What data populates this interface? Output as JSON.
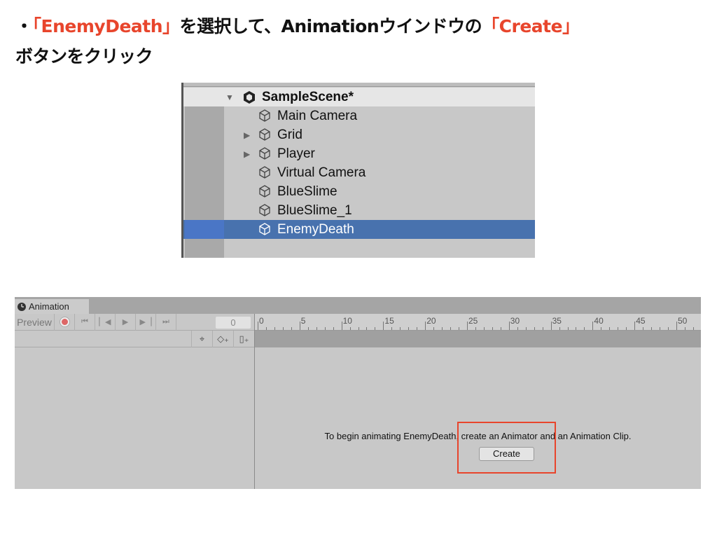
{
  "instruction": {
    "line1": [
      {
        "text": "・",
        "red": false
      },
      {
        "text": "「EnemyDeath」",
        "red": true
      },
      {
        "text": "を選択して、Animationウインドウの",
        "red": false
      },
      {
        "text": "「Create」",
        "red": true
      }
    ],
    "line2": "ボタンをクリック"
  },
  "hierarchy": {
    "scene": "SampleScene*",
    "items": [
      {
        "label": "Main Camera",
        "expandable": false
      },
      {
        "label": "Grid",
        "expandable": true
      },
      {
        "label": "Player",
        "expandable": true
      },
      {
        "label": "Virtual Camera",
        "expandable": false
      },
      {
        "label": "BlueSlime",
        "expandable": false
      },
      {
        "label": "BlueSlime_1",
        "expandable": false
      },
      {
        "label": "EnemyDeath",
        "expandable": false,
        "selected": true
      }
    ]
  },
  "animation": {
    "tab": "Animation",
    "preview": "Preview",
    "frame": "0",
    "ruler": [
      "0",
      "5",
      "10",
      "15",
      "20",
      "25",
      "30",
      "35",
      "40",
      "45",
      "50"
    ],
    "message": "To begin animating EnemyDeath, create an Animator and an Animation Clip.",
    "create": "Create"
  },
  "colors": {
    "highlight": "#e8452c",
    "selection": "#4872ae"
  }
}
